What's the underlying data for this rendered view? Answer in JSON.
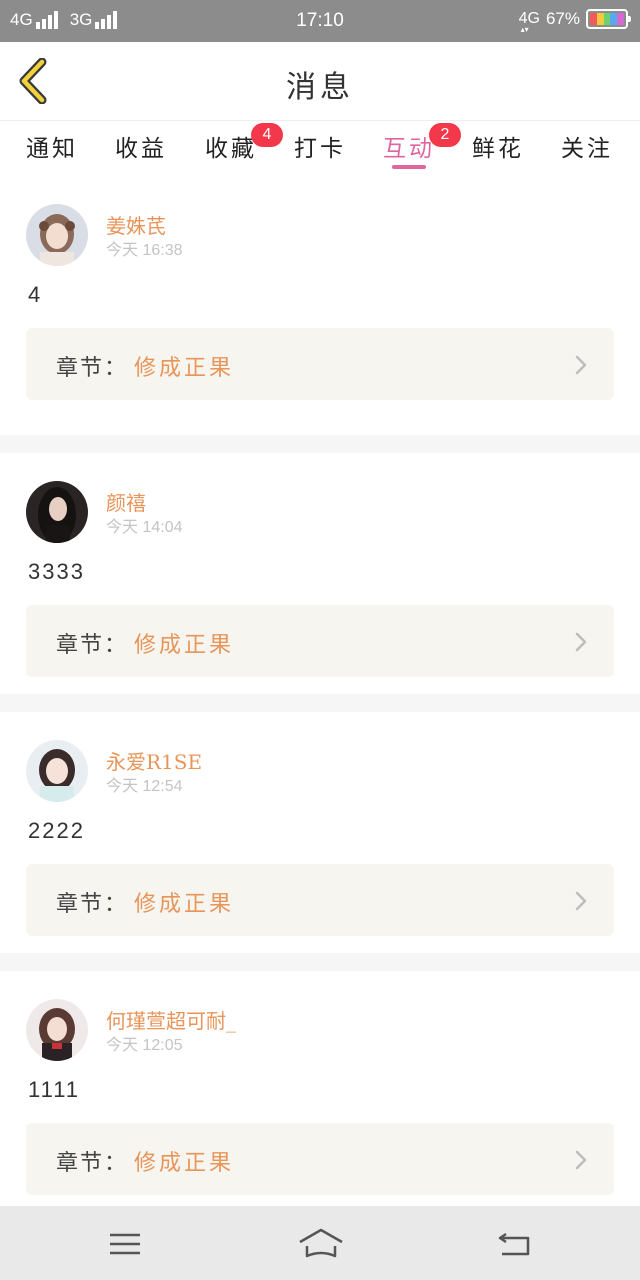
{
  "status_bar": {
    "network_1": "4G",
    "network_2": "3G",
    "time": "17:10",
    "network_3": "4G",
    "battery": "67%"
  },
  "header": {
    "title": "消息",
    "back_icon": "chevron-left-icon"
  },
  "tabs": [
    {
      "label": "通知",
      "badge": ""
    },
    {
      "label": "收益",
      "badge": ""
    },
    {
      "label": "收藏",
      "badge": "4"
    },
    {
      "label": "打卡",
      "badge": ""
    },
    {
      "label": "互动",
      "badge": "2",
      "active": true
    },
    {
      "label": "鲜花",
      "badge": ""
    },
    {
      "label": "关注",
      "badge": ""
    }
  ],
  "messages": [
    {
      "username": "姜姝芪",
      "time": "今天 16:38",
      "content": "4",
      "chapter_label": "章节：",
      "chapter_name": "修成正果"
    },
    {
      "username": "颜禧",
      "time": "今天 14:04",
      "content": "3333",
      "chapter_label": "章节：",
      "chapter_name": "修成正果"
    },
    {
      "username": "永爱R1SE",
      "time": "今天 12:54",
      "content": "2222",
      "chapter_label": "章节：",
      "chapter_name": "修成正果"
    },
    {
      "username": "何瑾萱超可耐_",
      "time": "今天 12:05",
      "content": "1111",
      "chapter_label": "章节：",
      "chapter_name": "修成正果"
    }
  ],
  "bottom_nav": {
    "menu_icon": "menu-icon",
    "home_icon": "home-icon",
    "back_icon": "back-arrow-icon"
  },
  "colors": {
    "accent": "#e066a0",
    "username": "#e8955a",
    "badge": "#f2384a",
    "back_icon": "#f2d23a"
  }
}
